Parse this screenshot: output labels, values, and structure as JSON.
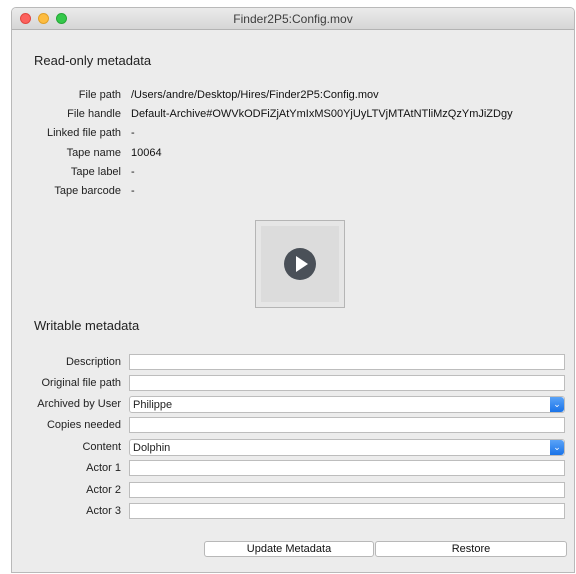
{
  "window": {
    "title": "Finder2P5:Config.mov"
  },
  "readonly": {
    "section_title": "Read-only metadata",
    "fields": [
      {
        "label": "File path",
        "value": "/Users/andre/Desktop/Hires/Finder2P5:Config.mov"
      },
      {
        "label": "File handle",
        "value": "Default-Archive#OWVkODFiZjAtYmIxMS00YjUyLTVjMTAtNTliMzQzYmJiZDgy"
      },
      {
        "label": "Linked file path",
        "value": "-"
      },
      {
        "label": "Tape name",
        "value": "10064"
      },
      {
        "label": "Tape label",
        "value": "-"
      },
      {
        "label": "Tape barcode",
        "value": "-"
      }
    ]
  },
  "preview": {
    "icon": "play-icon"
  },
  "writable": {
    "section_title": "Writable metadata",
    "fields": [
      {
        "label": "Description",
        "value": "",
        "type": "text"
      },
      {
        "label": "Original file path",
        "value": "",
        "type": "text"
      },
      {
        "label": "Archived by User",
        "value": "Philippe",
        "type": "select"
      },
      {
        "label": "Copies needed",
        "value": "",
        "type": "text"
      },
      {
        "label": "Content",
        "value": "Dolphin",
        "type": "select"
      },
      {
        "label": "Actor 1",
        "value": "",
        "type": "text"
      },
      {
        "label": "Actor 2",
        "value": "",
        "type": "text"
      },
      {
        "label": "Actor 3",
        "value": "",
        "type": "text"
      }
    ]
  },
  "buttons": {
    "update": "Update Metadata",
    "restore": "Restore"
  },
  "colors": {
    "select_accent": "#1a73e8",
    "window_bg": "#ececec"
  }
}
